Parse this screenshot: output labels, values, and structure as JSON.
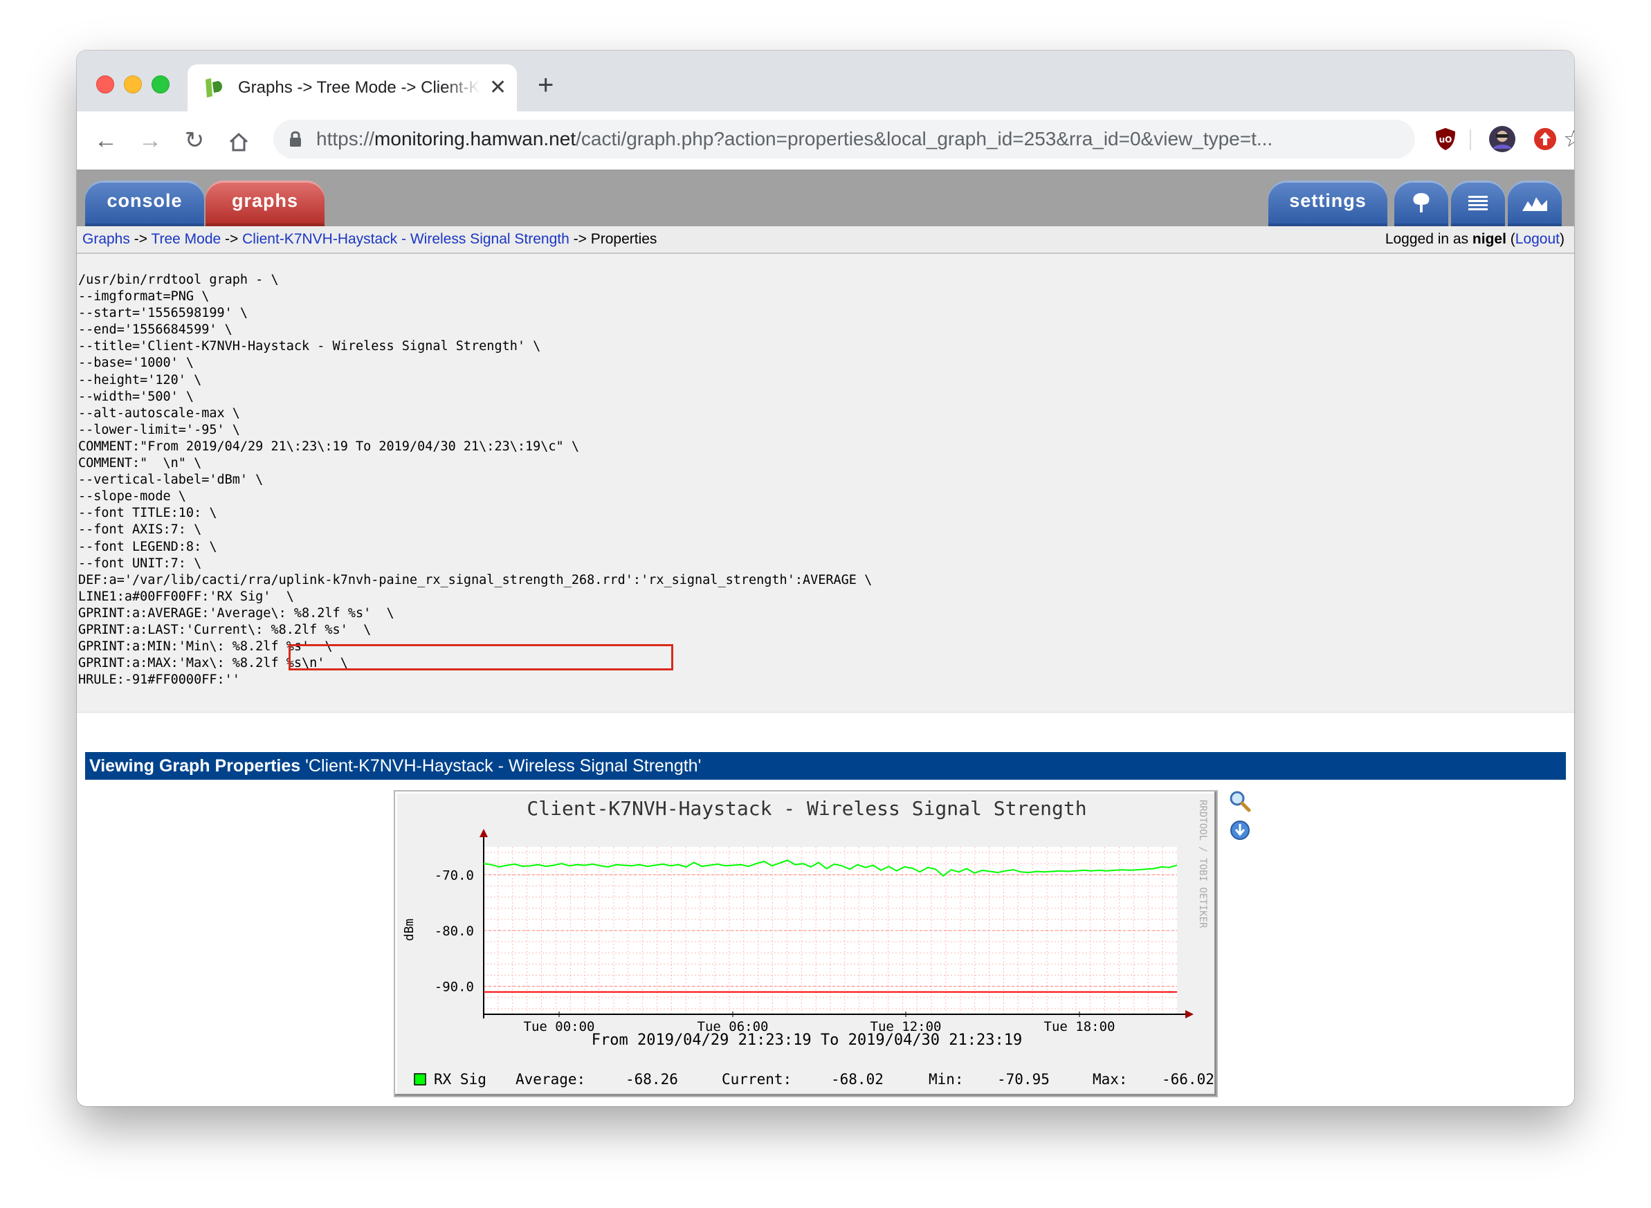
{
  "tab": {
    "title": "Graphs -> Tree Mode -> Client-K7NVH-Haystack - Wireless Signal Strength"
  },
  "address": {
    "host_prefix": "https://",
    "host": "monitoring.hamwan.net",
    "path": "/cacti/graph.php?action=properties&local_graph_id=253&rra_id=0&view_type=t..."
  },
  "cacti_tabs": {
    "console": "console",
    "graphs": "graphs",
    "settings": "settings"
  },
  "breadcrumb": {
    "graphs": "Graphs",
    "sep": " -> ",
    "tree_mode": "Tree Mode",
    "graph": "Client-K7NVH-Haystack - Wireless Signal Strength",
    "current": "Properties"
  },
  "login": {
    "prefix": "Logged in as ",
    "user": "nigel",
    "open": " (",
    "logout": "Logout",
    "close": ")"
  },
  "command": {
    "lines": [
      "/usr/bin/rrdtool graph - \\",
      "--imgformat=PNG \\",
      "--start='1556598199' \\",
      "--end='1556684599' \\",
      "--title='Client-K7NVH-Haystack - Wireless Signal Strength' \\",
      "--base='1000' \\",
      "--height='120' \\",
      "--width='500' \\",
      "--alt-autoscale-max \\",
      "--lower-limit='-95' \\",
      "COMMENT:\"From 2019/04/29 21\\:23\\:19 To 2019/04/30 21\\:23\\:19\\c\" \\",
      "COMMENT:\"  \\n\" \\",
      "--vertical-label='dBm' \\",
      "--slope-mode \\",
      "--font TITLE:10: \\",
      "--font AXIS:7: \\",
      "--font LEGEND:8: \\",
      "--font UNIT:7: \\",
      "DEF:a='/var/lib/cacti/rra/uplink-k7nvh-paine_rx_signal_strength_268.rrd':'rx_signal_strength':AVERAGE \\",
      "LINE1:a#00FF00FF:'RX Sig'  \\",
      "GPRINT:a:AVERAGE:'Average\\: %8.2lf %s'  \\",
      "GPRINT:a:LAST:'Current\\: %8.2lf %s'  \\",
      "GPRINT:a:MIN:'Min\\: %8.2lf %s'  \\",
      "GPRINT:a:MAX:'Max\\: %8.2lf %s\\n'  \\",
      "HRULE:-91#FF0000FF:''"
    ]
  },
  "properties_bar": {
    "bold": "Viewing Graph Properties",
    "name": " 'Client-K7NVH-Haystack - Wireless Signal Strength'"
  },
  "graph": {
    "title": "Client-K7NVH-Haystack - Wireless Signal Strength",
    "ylabel": "dBm",
    "watermark": "RRDTOOL / TOBI OETIKER",
    "ytick_labels": [
      "-70.0",
      "-80.0",
      "-90.0"
    ],
    "xtick_labels": [
      "Tue 00:00",
      "Tue 06:00",
      "Tue 12:00",
      "Tue 18:00"
    ],
    "range_text": "From 2019/04/29 21:23:19 To 2019/04/30 21:23:19",
    "legend": {
      "series": "RX Sig",
      "average_label": "Average:",
      "average": "-68.26",
      "current_label": "Current:",
      "current": "-68.02",
      "min_label": "Min:",
      "min": "-70.95",
      "max_label": "Max:",
      "max": "-66.02"
    },
    "colors": {
      "series": "#00ff00",
      "hrule": "#ff0000",
      "grid": "#ff9999"
    }
  },
  "chart_data": {
    "type": "line",
    "title": "Client-K7NVH-Haystack - Wireless Signal Strength",
    "ylabel": "dBm",
    "xlabel": "",
    "x_range": [
      "2019/04/29 21:23:19",
      "2019/04/30 21:23:19"
    ],
    "xticks": [
      "Tue 00:00",
      "Tue 06:00",
      "Tue 12:00",
      "Tue 18:00"
    ],
    "yticks": [
      -70,
      -80,
      -90
    ],
    "ylim": [
      -95,
      -65
    ],
    "grid": true,
    "legend_position": "bottom",
    "series": [
      {
        "name": "RX Sig",
        "color": "#00ff00",
        "values": [
          -68.0,
          -68.2,
          -68.6,
          -68.3,
          -68.1,
          -68.5,
          -68.4,
          -68.2,
          -68.5,
          -68.3,
          -68.0,
          -68.4,
          -68.2,
          -68.3,
          -68.1,
          -68.4,
          -68.6,
          -68.2,
          -68.3,
          -68.4,
          -68.2,
          -68.5,
          -68.3,
          -68.1,
          -68.4,
          -68.2,
          -68.6,
          -67.8,
          -68.5,
          -68.3,
          -68.1,
          -68.4,
          -68.3,
          -68.2,
          -68.5,
          -68.0,
          -67.6,
          -68.4,
          -67.9,
          -67.4,
          -68.2,
          -68.0,
          -68.6,
          -67.8,
          -68.9,
          -68.1,
          -68.4,
          -69.0,
          -68.2,
          -68.7,
          -68.3,
          -69.2,
          -68.5,
          -69.3,
          -68.6,
          -68.8,
          -69.5,
          -68.7,
          -69.0,
          -70.2,
          -69.1,
          -69.5,
          -68.9,
          -69.7,
          -69.2,
          -69.4,
          -69.6,
          -69.3,
          -69.1,
          -69.5,
          -69.6,
          -69.4,
          -69.5,
          -69.4,
          -69.3,
          -69.4,
          -69.3,
          -69.2,
          -69.3,
          -69.2,
          -69.3,
          -69.2,
          -69.1,
          -69.2,
          -69.1,
          -69.0,
          -68.9,
          -68.6,
          -68.7,
          -68.3
        ]
      },
      {
        "name": "HRULE",
        "color": "#ff0000",
        "values": [
          -91
        ]
      }
    ],
    "stats": {
      "average": -68.26,
      "current": -68.02,
      "min": -70.95,
      "max": -66.02
    }
  }
}
